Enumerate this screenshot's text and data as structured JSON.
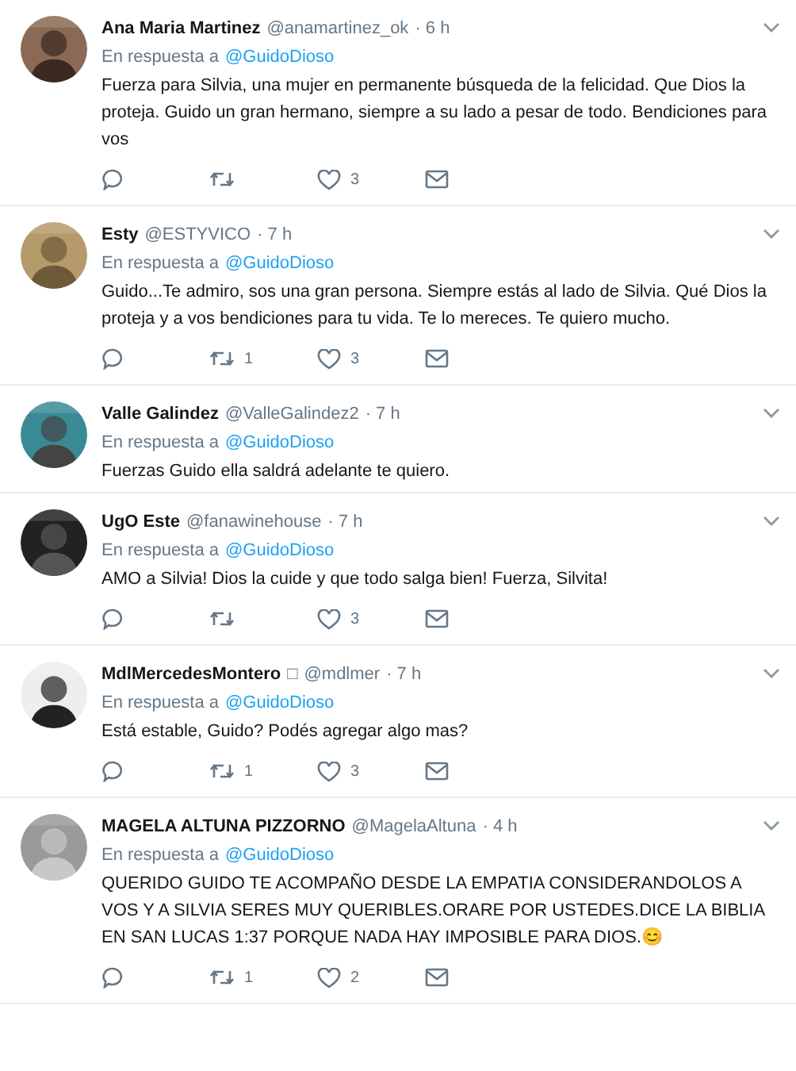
{
  "tweets": [
    {
      "name": "Ana Maria Martinez",
      "handle": "@anamartinez_ok",
      "time": "· 6 h",
      "reply_label": "En respuesta a",
      "reply_to": "@GuidoDioso",
      "text": "Fuerza para Silvia, una mujer en permanente búsqueda de la felicidad.  Que Dios la proteja. Guido un gran hermano, siempre a su lado a pesar de todo. Bendiciones para vos",
      "actions": {
        "likes": "3"
      }
    },
    {
      "name": "Esty",
      "handle": "@ESTYVICO",
      "time": "· 7 h",
      "reply_label": "En respuesta a",
      "reply_to": "@GuidoDioso",
      "text": "Guido...Te admiro, sos una gran persona. Siempre estás al lado de Silvia. Qué Dios la proteja y a vos bendiciones para tu vida. Te lo mereces. Te quiero mucho.",
      "actions": {
        "retweets": "1",
        "likes": "3"
      }
    },
    {
      "name": "Valle Galindez",
      "handle": "@ValleGalindez2",
      "time": "· 7 h",
      "reply_label": "En respuesta a",
      "reply_to": "@GuidoDioso",
      "text": "Fuerzas Guido ella saldrá adelante te quiero."
    },
    {
      "name": "UgO Este",
      "handle": "@fanawinehouse",
      "time": "· 7 h",
      "reply_label": "En respuesta a",
      "reply_to": "@GuidoDioso",
      "text": "AMO a Silvia! Dios la cuide y que todo salga bien! Fuerza, Silvita!",
      "actions": {
        "likes": "3"
      }
    },
    {
      "name": "MdlMercedesMontero",
      "badge": "□",
      "handle": "@mdlmer",
      "time": "· 7 h",
      "reply_label": "En respuesta a",
      "reply_to": "@GuidoDioso",
      "text": "Está estable, Guido? Podés agregar algo mas?",
      "actions": {
        "retweets": "1",
        "likes": "3"
      }
    },
    {
      "name": "MAGELA ALTUNA PIZZORNO",
      "handle": "@MagelaAltuna",
      "time": "· 4 h",
      "reply_label": "En respuesta a",
      "reply_to": "@GuidoDioso",
      "text": "QUERIDO GUIDO TE ACOMPAÑO DESDE LA EMPATIA CONSIDERANDOLOS A VOS Y A SILVIA SERES MUY QUERIBLES.ORARE POR USTEDES.DICE LA BIBLIA EN SAN LUCAS 1:37 PORQUE NADA HAY IMPOSIBLE PARA DIOS.😊",
      "actions": {
        "retweets": "1",
        "likes": "2"
      }
    }
  ]
}
